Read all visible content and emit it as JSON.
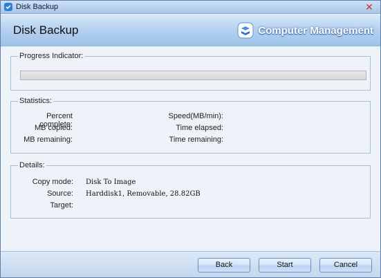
{
  "window": {
    "title": "Disk Backup",
    "close_glyph": "✕"
  },
  "banner": {
    "heading": "Disk Backup",
    "brand": "Computer Management"
  },
  "progress": {
    "legend": "Progress Indicator:",
    "fraction": 0
  },
  "statistics": {
    "legend": "Statistics:",
    "left": [
      {
        "label": "Percent complete:",
        "value": ""
      },
      {
        "label": "MB copied:",
        "value": ""
      },
      {
        "label": "MB remaining:",
        "value": ""
      }
    ],
    "right": [
      {
        "label": "Speed(MB/min):",
        "value": ""
      },
      {
        "label": "Time elapsed:",
        "value": ""
      },
      {
        "label": "Time remaining:",
        "value": ""
      }
    ]
  },
  "details": {
    "legend": "Details:",
    "rows": [
      {
        "label": "Copy mode:",
        "value": "Disk To Image"
      },
      {
        "label": "Source:",
        "value": "Harddisk1, Removable, 28.82GB"
      },
      {
        "label": "Target:",
        "value": ""
      }
    ]
  },
  "buttons": {
    "back": "Back",
    "start": "Start",
    "cancel": "Cancel"
  },
  "colors": {
    "accent": "#4aa8e8",
    "banner": "#b7d2f0",
    "window": "#eef3fa"
  },
  "icons": {
    "app": "disk-backup-app-icon",
    "brand": "computer-management-logo-icon",
    "close": "close-icon"
  }
}
